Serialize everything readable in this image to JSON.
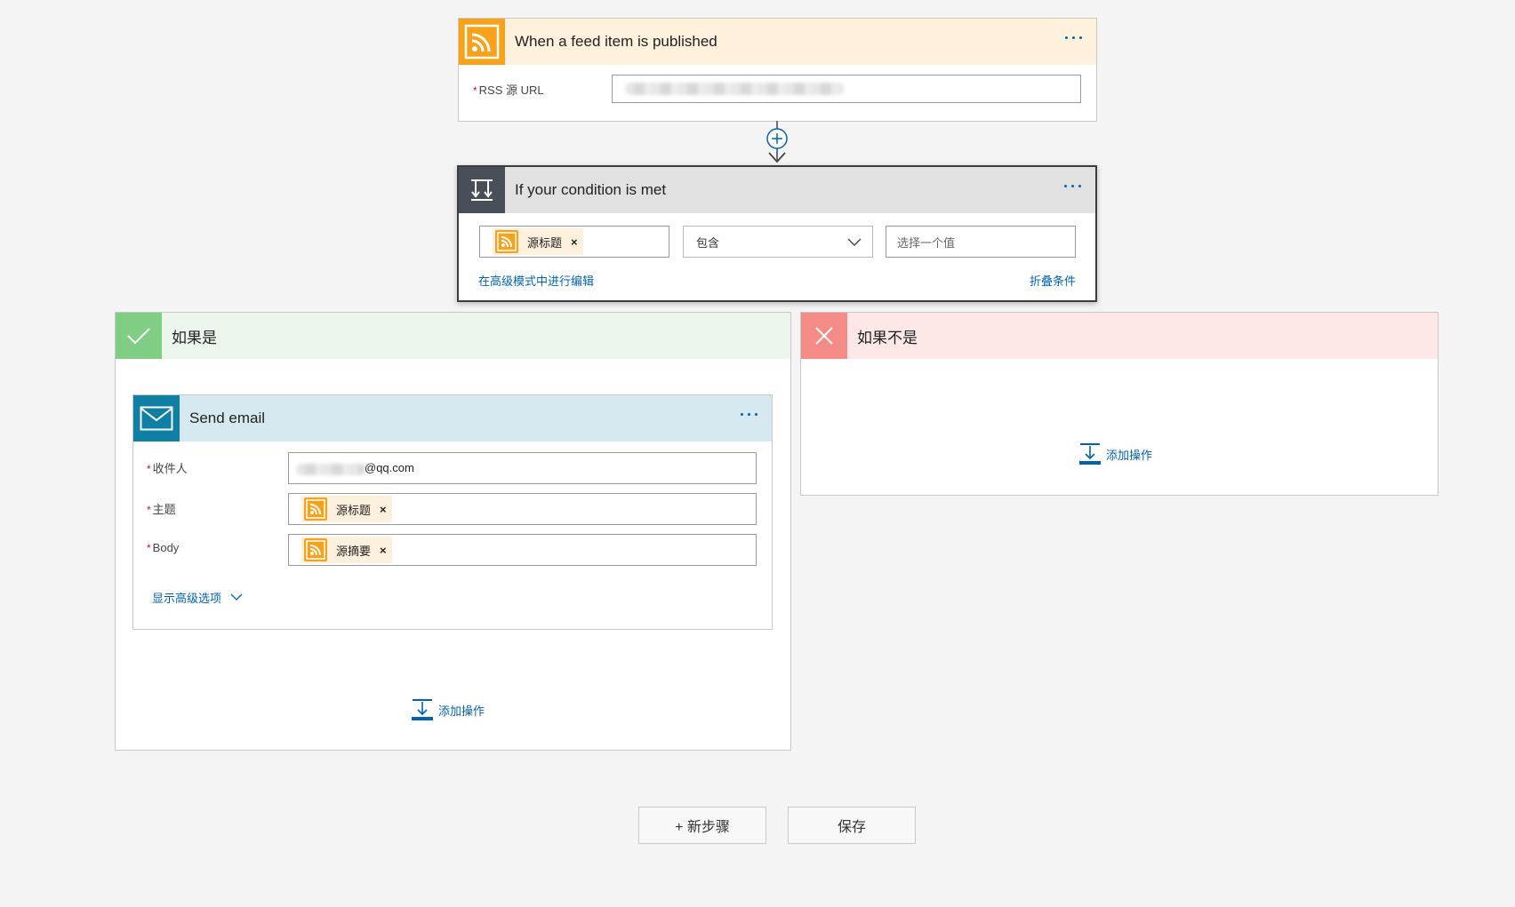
{
  "trigger": {
    "title": "When a feed item is published",
    "header_bg": "#fff1dc",
    "icon": "rss-icon",
    "field_label": "RSS 源 URL",
    "field_required": "*"
  },
  "condition": {
    "title": "If your condition is met",
    "header_bg": "#e1e1e1",
    "icon": "condition-icon",
    "left_token": "源标题",
    "operator": "包含",
    "value_placeholder": "选择一个值",
    "advanced_link": "在高级模式中进行编辑",
    "collapse_link": "折叠条件"
  },
  "yes_branch": {
    "title": "如果是",
    "header_bg": "#edf6ec",
    "icon_bg": "#7fce84",
    "add_action": "添加操作",
    "send_email": {
      "title": "Send email",
      "header_bg": "#d7e9f0",
      "icon_bg": "#0f7fa3",
      "fields": [
        {
          "label": "收件人",
          "value_suffix": "@qq.com"
        },
        {
          "label": "主题",
          "token": "源标题"
        },
        {
          "label": "Body",
          "token": "源摘要"
        }
      ],
      "advanced_options": "显示高级选项"
    }
  },
  "no_branch": {
    "title": "如果不是",
    "header_bg": "#fde7e7",
    "icon_bg": "#f58b86",
    "add_action": "添加操作"
  },
  "footer": {
    "new_step": "+ 新步骤",
    "save": "保存"
  },
  "colors": {
    "accent": "#0063b1",
    "rss_orange": "#f7a21a",
    "required_red": "#c8102e"
  }
}
